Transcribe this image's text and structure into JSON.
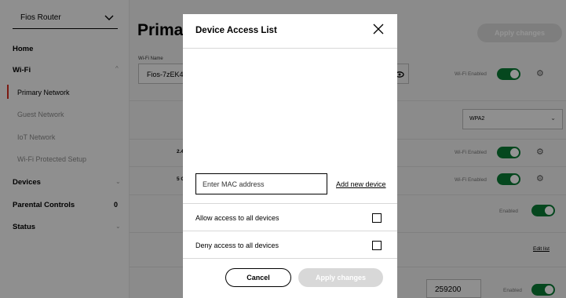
{
  "sidebar": {
    "router_select": "Fios Router",
    "items": [
      {
        "label": "Home"
      },
      {
        "label": "Wi-Fi"
      },
      {
        "label": "Primary Network"
      },
      {
        "label": "Guest Network"
      },
      {
        "label": "IoT Network"
      },
      {
        "label": "Wi-Fi Protected Setup"
      },
      {
        "label": "Devices"
      },
      {
        "label": "Parental Controls"
      },
      {
        "label": "Status"
      }
    ],
    "parental_badge": "0"
  },
  "main": {
    "page_title": "Prima",
    "apply_changes": "Apply changes",
    "wifi_name_label": "Wi-Fi Name",
    "wifi_name_value": "Fios-7zEK4",
    "wifi_enabled_label": "Wi-Fi Enabled",
    "security_value": "WPA2",
    "band_24": "2.4",
    "band_5": "5 G",
    "enabled_label": "Enabled",
    "edit_list": "Edit list",
    "lease_value": "259200"
  },
  "modal": {
    "title": "Device Access List",
    "mac_placeholder": "Enter MAC address",
    "add_new_device": "Add new device",
    "allow_all": "Allow access to all devices",
    "deny_all": "Deny access to all devices",
    "cancel": "Cancel",
    "apply": "Apply changes"
  },
  "colors": {
    "accent_red": "#d52b1e",
    "toggle_green": "#0a7a35"
  }
}
